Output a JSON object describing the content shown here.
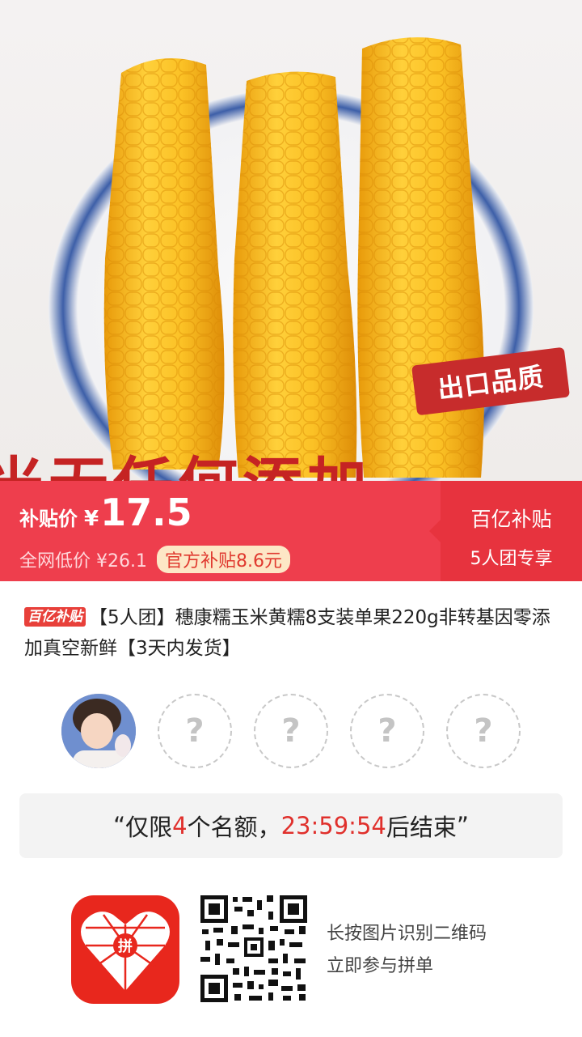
{
  "hero": {
    "badge": "出口品质",
    "caption": "米无任何添加"
  },
  "price": {
    "label": "补贴价",
    "currency": "¥",
    "value": "17.5",
    "original": "全网低价 ¥26.1",
    "subsidy": "官方补贴8.6元",
    "program_line1": "百亿补贴",
    "program_line2": "5人团专享"
  },
  "product": {
    "tag": "百亿补贴",
    "title": "【5人团】穗康糯玉米黄糯8支装单果220g非转基因零添加真空新鲜【3天内发货】"
  },
  "group": {
    "slots": [
      "",
      "?",
      "?",
      "?",
      "?"
    ]
  },
  "countdown": {
    "open_quote": "“",
    "prefix": "仅限",
    "count": "4",
    "middle": "个名额，",
    "time": "23:59:54",
    "suffix": "后结束",
    "close_quote": "”"
  },
  "footer": {
    "logo_char": "拼",
    "hint_line1": "长按图片识别二维码",
    "hint_line2": "立即参与拼单"
  },
  "colors": {
    "primary_red": "#ee3e4d",
    "accent_red": "#e7333e",
    "pill_bg": "#fde7c6",
    "corn_yellow": "#f6b819"
  }
}
